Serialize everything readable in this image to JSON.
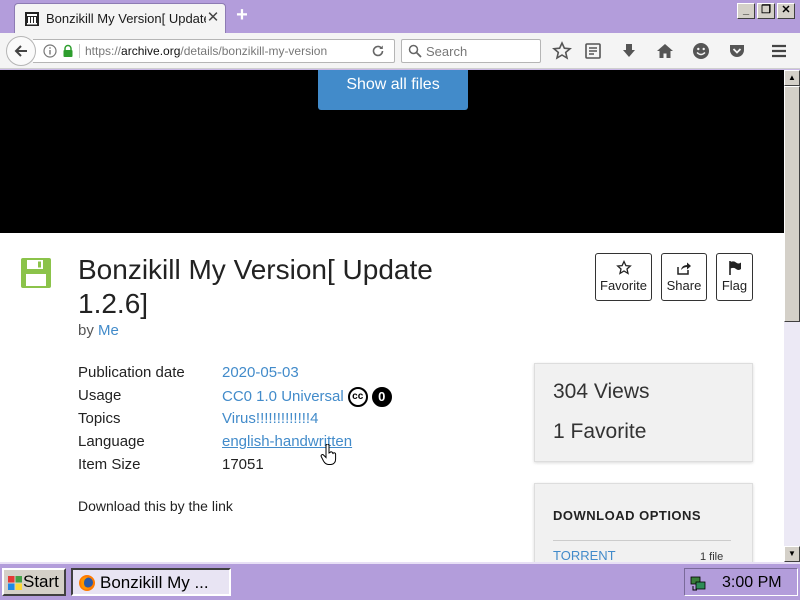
{
  "browser": {
    "tab_title": "Bonzikill My Version[ Update 1.2.6]",
    "url_prefix": "https://",
    "url_host": "archive.org",
    "url_path": "/details/bonzikill-my-version",
    "search_placeholder": "Search"
  },
  "page": {
    "show_files_label": "Show all files",
    "title": "Bonzikill My Version[ Update 1.2.6]",
    "by_label": "by",
    "author": "Me",
    "actions": {
      "favorite": "Favorite",
      "share": "Share",
      "flag": "Flag"
    },
    "metadata": [
      {
        "label": "Publication date",
        "value": "2020-05-03"
      },
      {
        "label": "Usage",
        "value": "CC0 1.0 Universal"
      },
      {
        "label": "Topics",
        "value": "Virus!!!!!!!!!!!!!4"
      },
      {
        "label": "Language",
        "value": "english-handwritten"
      },
      {
        "label": "Item Size",
        "value": "17051"
      }
    ],
    "license_badges": [
      "cc",
      "0"
    ],
    "description": "Download this by the link",
    "stats": {
      "views": "304 Views",
      "favorites": "1 Favorite"
    },
    "download": {
      "title": "DOWNLOAD OPTIONS",
      "option_label": "TORRENT",
      "option_count": "1 file"
    }
  },
  "taskbar": {
    "start_label": "Start",
    "task_label": "Bonzikill My ...",
    "clock": "3:00 PM"
  },
  "colors": {
    "link": "#428bca",
    "theme": "#b39ddb",
    "media_band": "#000000"
  }
}
